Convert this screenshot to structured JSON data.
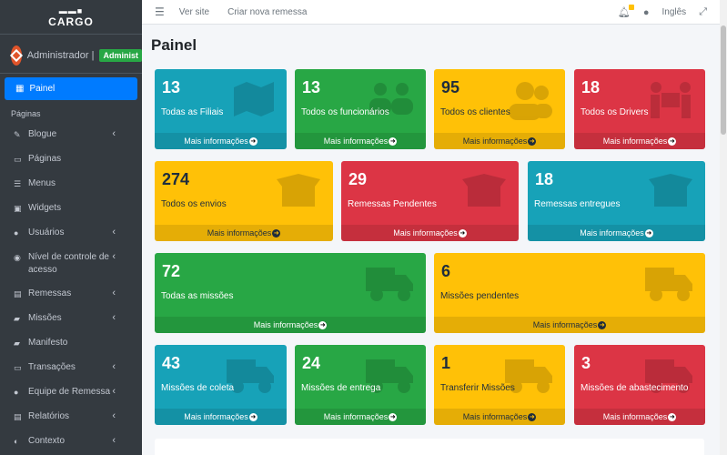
{
  "brand": {
    "name": "CARGO"
  },
  "user": {
    "name": "Administrador |",
    "badge": "Administ"
  },
  "topbar": {
    "visit_site": "Ver site",
    "new_shipment": "Criar nova remessa",
    "language": "Inglês"
  },
  "sidebar": {
    "active": "Painel",
    "section": "Páginas",
    "items": [
      {
        "label": "Blogue",
        "chev": "‹"
      },
      {
        "label": "Páginas",
        "chev": ""
      },
      {
        "label": "Menus",
        "chev": ""
      },
      {
        "label": "Widgets",
        "chev": ""
      },
      {
        "label": "Usuários",
        "chev": "‹"
      },
      {
        "label": "Nível de controle de acesso",
        "chev": "‹"
      },
      {
        "label": "Remessas",
        "chev": "‹"
      },
      {
        "label": "Missões",
        "chev": "‹"
      },
      {
        "label": "Manifesto",
        "chev": ""
      },
      {
        "label": "Transações",
        "chev": "‹"
      },
      {
        "label": "Equipe de Remessa",
        "chev": "‹"
      },
      {
        "label": "Relatórios",
        "chev": "‹"
      },
      {
        "label": "Contexto",
        "chev": "‹"
      }
    ]
  },
  "page": {
    "title": "Painel",
    "more_info": "Mais informações"
  },
  "boxes": [
    {
      "num": "13",
      "label": "Todas as Filiais",
      "color": "#17a2b8"
    },
    {
      "num": "13",
      "label": "Todos os funcionários",
      "color": "#28a745"
    },
    {
      "num": "95",
      "label": "Todos os clientes",
      "color": "#ffc107"
    },
    {
      "num": "18",
      "label": "Todos os Drivers",
      "color": "#dc3545"
    },
    {
      "num": "274",
      "label": "Todos os envios",
      "color": "#ffc107"
    },
    {
      "num": "29",
      "label": "Remessas Pendentes",
      "color": "#dc3545"
    },
    {
      "num": "18",
      "label": "Remessas entregues",
      "color": "#17a2b8"
    },
    {
      "num": "72",
      "label": "Todas as missões",
      "color": "#28a745"
    },
    {
      "num": "6",
      "label": "Missões pendentes",
      "color": "#ffc107"
    },
    {
      "num": "43",
      "label": "Missões de coleta",
      "color": "#17a2b8"
    },
    {
      "num": "24",
      "label": "Missões de entrega",
      "color": "#28a745"
    },
    {
      "num": "1",
      "label": "Transferir Missões",
      "color": "#ffc107"
    },
    {
      "num": "3",
      "label": "Missões de abastecimento",
      "color": "#dc3545"
    }
  ]
}
